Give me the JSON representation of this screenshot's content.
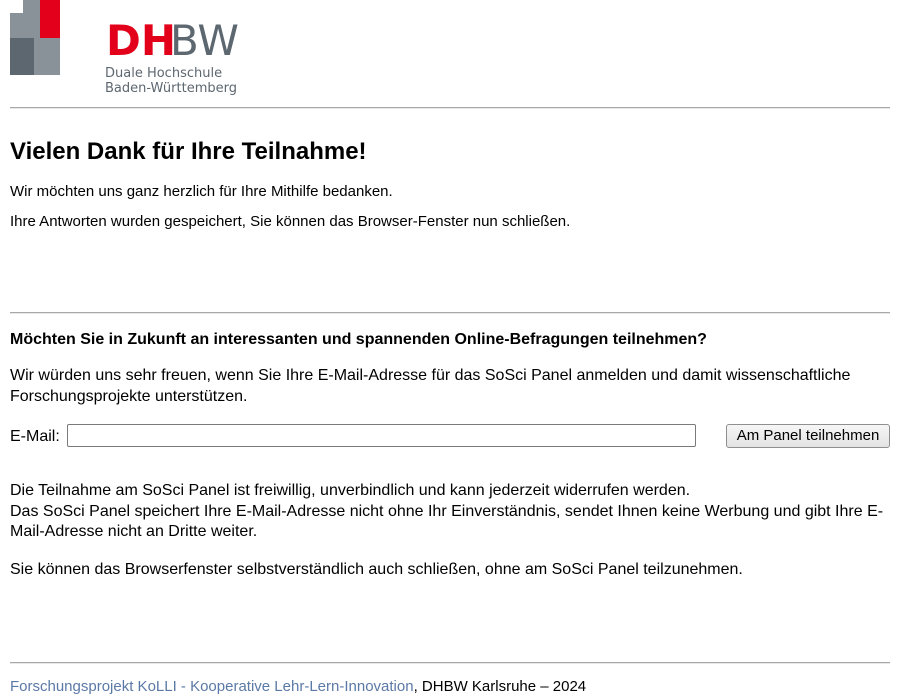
{
  "brand": {
    "logo_letters_red": "DH",
    "logo_letters_gray": "BW",
    "logo_line_1": "Duale Hochschule",
    "logo_line_2": "Baden-Württemberg",
    "red": "#e2001a",
    "gray": "#5d6770"
  },
  "thanks": {
    "heading": "Vielen Dank für Ihre Teilnahme!",
    "line_1": "Wir möchten uns ganz herzlich für Ihre Mithilfe bedanken.",
    "line_2": "Ihre Antworten wurden gespeichert, Sie können das Browser-Fenster nun schließen."
  },
  "panel": {
    "question": "Möchten Sie in Zukunft an interessanten und spannenden Online-Befragungen teilnehmen?",
    "intro": "Wir würden uns sehr freuen, wenn Sie Ihre E-Mail-Adresse für das SoSci Panel anmelden und damit wissenschaftliche Forschungsprojekte unterstützen.",
    "email_label": "E-Mail:",
    "email_value": "",
    "join_button": "Am Panel teilnehmen",
    "info_1": "Die Teilnahme am SoSci Panel ist freiwillig, unverbindlich und kann jederzeit widerrufen werden.",
    "info_2": "Das SoSci Panel speichert Ihre E-Mail-Adresse nicht ohne Ihr Einverständnis, sendet Ihnen keine Werbung und gibt Ihre E-Mail-Adresse nicht an Dritte weiter.",
    "close_note": "Sie können das Browserfenster selbstverständlich auch schließen, ohne am SoSci Panel teilzunehmen."
  },
  "footer": {
    "link_text": "Forschungsprojekt KoLLI - Kooperative Lehr-Lern-Innovation",
    "rest_text": ", DHBW Karlsruhe – 2024",
    "link_color": "#5b79a6"
  }
}
